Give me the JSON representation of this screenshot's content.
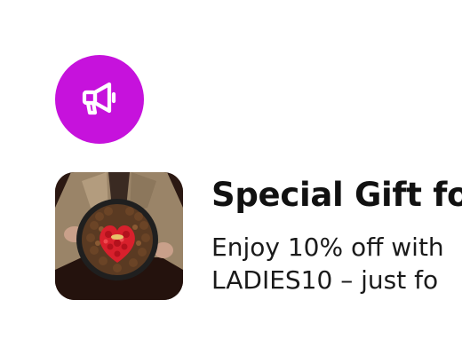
{
  "notification": {
    "icon": "megaphone-icon",
    "icon_bg_color": "#c612dc",
    "icon_fg_color": "#ffffff",
    "title": "Special Gift fo",
    "message_line1": "Enjoy 10% off with",
    "message_line2": "LADIES10 – just fo",
    "image": "chocolate-rose-gift-box"
  }
}
